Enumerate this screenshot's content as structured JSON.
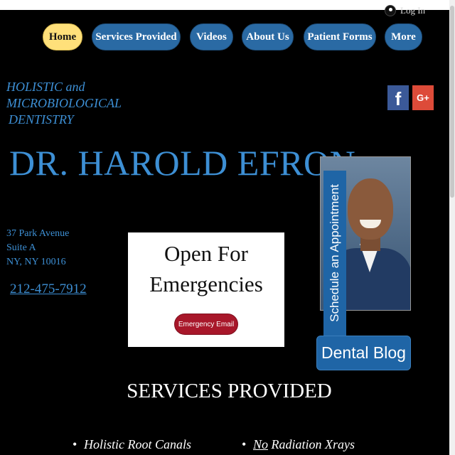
{
  "header": {
    "login_text": "Log In"
  },
  "nav": {
    "items": [
      {
        "label": "Home",
        "active": true
      },
      {
        "label": "Services Provided",
        "active": false
      },
      {
        "label": "Videos",
        "active": false
      },
      {
        "label": "About Us",
        "active": false
      },
      {
        "label": "Patient Forms",
        "active": false
      },
      {
        "label": "More",
        "active": false
      }
    ]
  },
  "tagline": {
    "line1": "HOLISTIC and",
    "line2": "MICROBIOLOGICAL",
    "line3": "DENTISTRY"
  },
  "social": {
    "facebook_glyph": "f",
    "google_glyph": "G+"
  },
  "doctor": {
    "name": "DR. HAROLD EFRON"
  },
  "address": {
    "line1": "37 Park Avenue",
    "line2": "Suite A",
    "line3": "NY, NY 10016"
  },
  "phone": "212-475-7912",
  "emergency": {
    "line1": "Open For",
    "line2": "Emergencies",
    "button_label": "Emergency Email"
  },
  "schedule_label": "Schedule an Appointment",
  "blog_label": "Dental Blog",
  "services": {
    "heading": "SERVICES PROVIDED",
    "col1": [
      "Holistic Root Canals"
    ],
    "col2_prefix": "No",
    "col2_item": " Radiation Xrays"
  },
  "colors": {
    "accent_blue": "#3d8fd4",
    "nav_blue": "#2a6aa4",
    "nav_active": "#ffe07a",
    "emergency_red": "#a8172a"
  }
}
